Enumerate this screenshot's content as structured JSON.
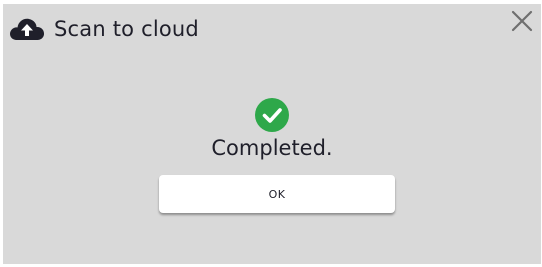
{
  "dialog": {
    "title": "Scan to cloud",
    "title_icon": "cloud-upload-icon",
    "close_icon": "close-icon"
  },
  "status": {
    "icon": "check-circle-icon",
    "message": "Completed."
  },
  "actions": {
    "ok_label": "OK"
  },
  "colors": {
    "background": "#d9d9d9",
    "success": "#2ea84a",
    "text": "#1f1f2a",
    "button": "#ffffff",
    "icon": "#1f1f2a"
  }
}
